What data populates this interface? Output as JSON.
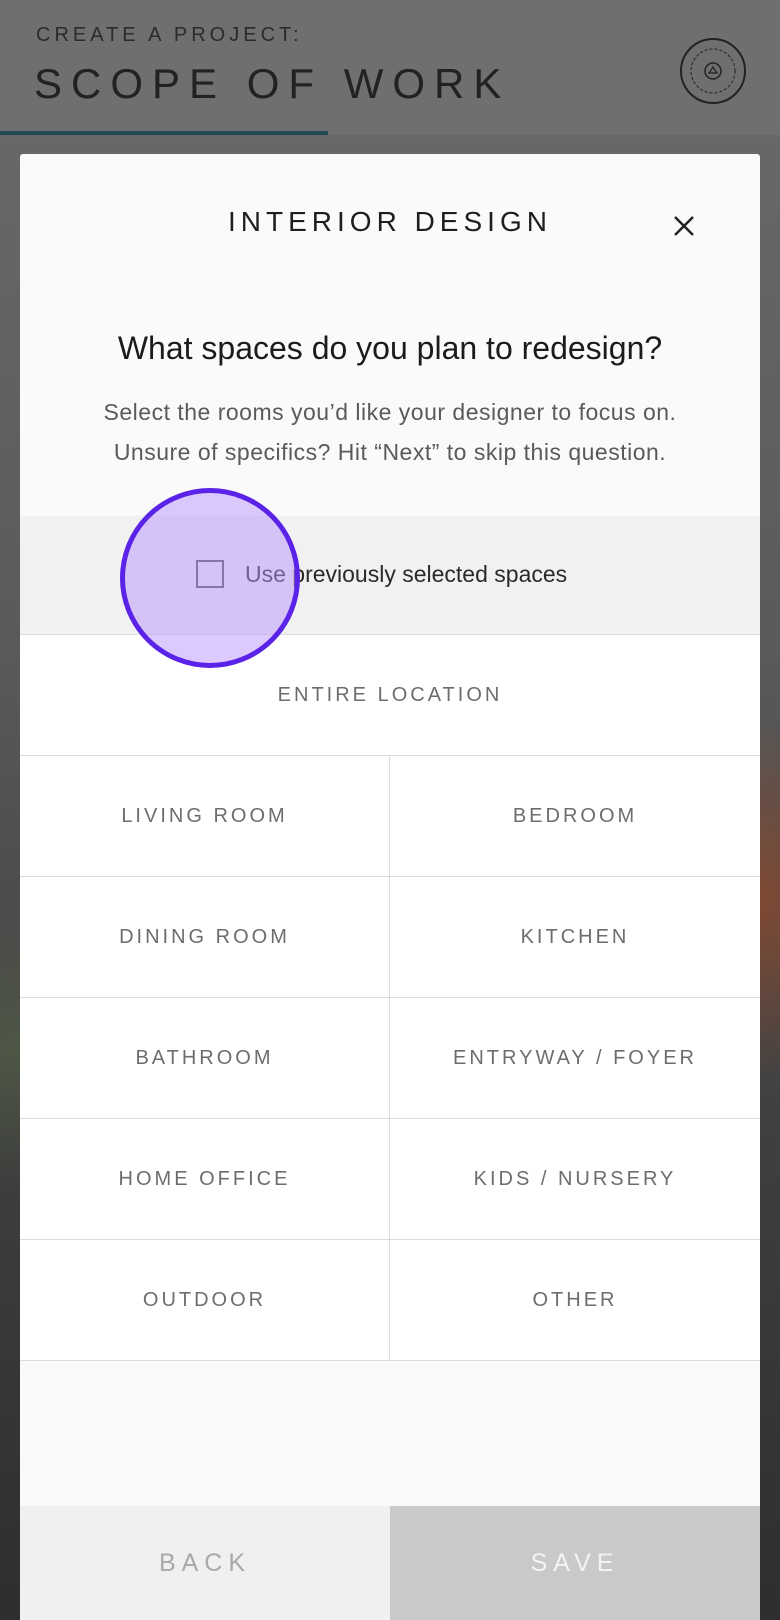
{
  "header": {
    "eyebrow": "CREATE A PROJECT:",
    "title": "SCOPE OF WORK",
    "logo_icon": "homepolish-logo-icon",
    "progress_fraction": 0.42,
    "progress_color": "#1f4a56"
  },
  "modal": {
    "title": "INTERIOR DESIGN",
    "close_icon": "close-icon",
    "question": "What spaces do you plan to redesign?",
    "subtext_line1": "Select the rooms you’d like your designer to focus on.",
    "subtext_line2": "Unsure of specifics? Hit “Next” to skip this question.",
    "use_previous_label": "Use previously selected spaces",
    "use_previous_checked": false
  },
  "spaces": {
    "entire": "ENTIRE LOCATION",
    "living_room": "LIVING ROOM",
    "bedroom": "BEDROOM",
    "dining_room": "DINING ROOM",
    "kitchen": "KITCHEN",
    "bathroom": "BATHROOM",
    "entryway": "ENTRYWAY / FOYER",
    "home_office": "HOME OFFICE",
    "kids_nursery": "KIDS / NURSERY",
    "outdoor": "OUTDOOR",
    "other": "OTHER"
  },
  "footer": {
    "back_label": "BACK",
    "save_label": "SAVE"
  },
  "colors": {
    "tap_indicator_fill": "#ba96ff",
    "tap_indicator_stroke": "#5b22e8"
  }
}
